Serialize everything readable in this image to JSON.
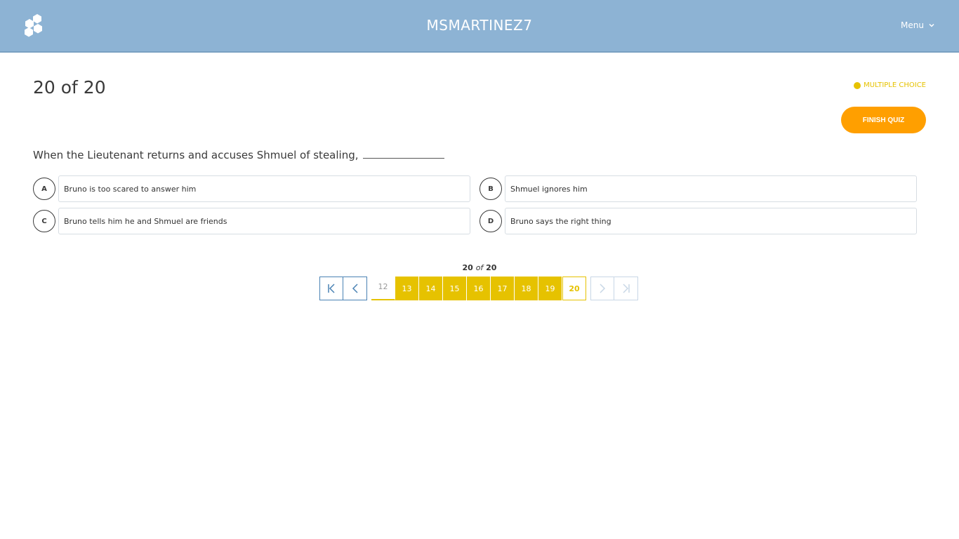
{
  "header": {
    "brand": "MSMARTINEZ7",
    "menu_label": "Menu"
  },
  "quiz": {
    "counter": "20 of 20",
    "type_label": "MULTIPLE CHOICE",
    "finish_label": "FINISH QUIZ",
    "question": "When the Lieutenant returns and accuses Shmuel of stealing,",
    "options": [
      {
        "letter": "A",
        "text": "Bruno is too scared to answer him"
      },
      {
        "letter": "B",
        "text": "Shmuel ignores him"
      },
      {
        "letter": "C",
        "text": "Bruno tells him he and Shmuel are friends"
      },
      {
        "letter": "D",
        "text": "Bruno says the right thing"
      }
    ]
  },
  "pagination": {
    "current": "20",
    "of_word": "of",
    "total": "20",
    "pages": [
      "12",
      "13",
      "14",
      "15",
      "16",
      "17",
      "18",
      "19",
      "20"
    ]
  },
  "colors": {
    "header": "#8db3d4",
    "accent_yellow": "#e6c200",
    "finish_orange": "#ff9f00",
    "nav_blue": "#4a82b4"
  }
}
